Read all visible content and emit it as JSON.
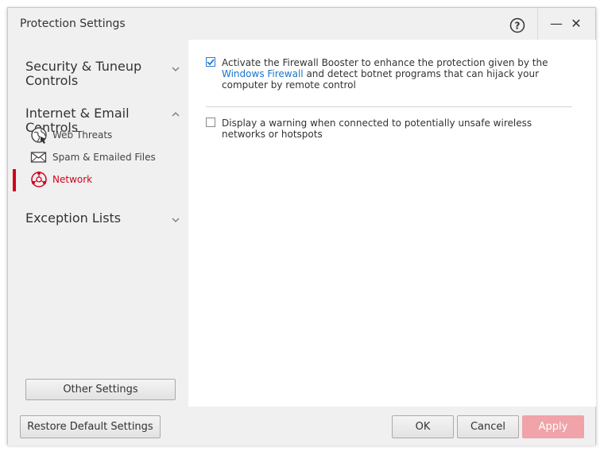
{
  "window": {
    "title": "Protection Settings",
    "help_icon": "help-circle-icon",
    "minimize_label": "—",
    "close_label": "✕"
  },
  "sidebar": {
    "categories": [
      {
        "label": "Security & Tuneup Controls",
        "expanded": false
      },
      {
        "label": "Internet & Email Controls",
        "expanded": true
      },
      {
        "label": "Exception Lists",
        "expanded": false
      }
    ],
    "sub_items": [
      {
        "label": "Web Threats",
        "icon": "globe-icon",
        "active": false
      },
      {
        "label": "Spam & Emailed Files",
        "icon": "envelope-icon",
        "active": false
      },
      {
        "label": "Network",
        "icon": "network-icon",
        "active": true
      }
    ],
    "other_settings_label": "Other Settings"
  },
  "main": {
    "option1": {
      "checked": true,
      "text_before": "Activate the Firewall Booster to enhance the protection given by the ",
      "link": "Windows Firewall",
      "text_after": " and detect botnet programs that can hijack your computer by remote control"
    },
    "option2": {
      "checked": false,
      "text": "Display a warning when connected to potentially unsafe wireless networks or hotspots"
    }
  },
  "footer": {
    "restore_label": "Restore Default Settings",
    "ok_label": "OK",
    "cancel_label": "Cancel",
    "apply_label": "Apply"
  },
  "colors": {
    "accent_red": "#d0021b",
    "link_blue": "#1a73c8",
    "apply_disabled": "#f0a3a8"
  }
}
